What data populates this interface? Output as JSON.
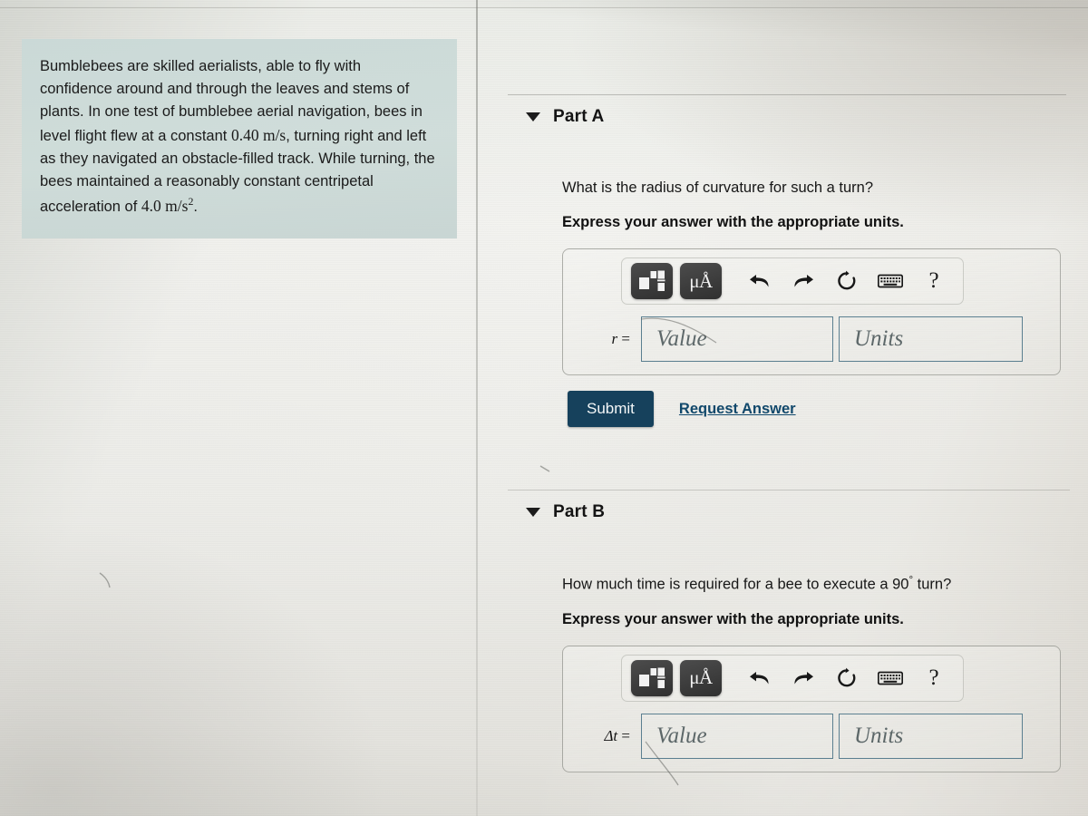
{
  "problem": {
    "text": "Bumblebees are skilled aerialists, able to fly with confidence around and through the leaves and stems of plants. In one test of bumblebee aerial navigation, bees in level flight flew at a constant ",
    "speed": "0.40 m/s",
    "text2": ", turning right and left as they navigated an obstacle-filled track. While turning, the bees maintained a reasonably constant centripetal acceleration of ",
    "accel": "4.0 m/s",
    "accel_exp": "2",
    "text3": "."
  },
  "toolbar": {
    "template_label": "math-template",
    "units_label": "μÅ",
    "undo_label": "undo",
    "redo_label": "redo",
    "reset_label": "reset",
    "keyboard_label": "keyboard",
    "help_label": "?"
  },
  "parts": [
    {
      "id": "A",
      "title": "Part A",
      "prompt": "What is the radius of curvature for such a turn?",
      "instruction": "Express your answer with the appropriate units.",
      "variable": "r",
      "variable_suffix": " =",
      "value_placeholder": "Value",
      "units_placeholder": "Units",
      "value_current": "",
      "units_current": "",
      "submit_label": "Submit",
      "request_label": "Request Answer"
    },
    {
      "id": "B",
      "title": "Part B",
      "prompt_pre": "How much time is required for a bee to execute a 90",
      "prompt_sup": "°",
      "prompt_post": " turn?",
      "instruction": "Express your answer with the appropriate units.",
      "variable": "Δt",
      "variable_suffix": " =",
      "value_placeholder": "Value",
      "units_placeholder": "Units",
      "value_current": "",
      "units_current": ""
    }
  ],
  "colors": {
    "problem_panel_bg": "#cadcd9",
    "submit_bg": "#16415c",
    "link": "#11486b",
    "field_border": "#5b7f90",
    "page_bg": "#f0f0ed"
  }
}
